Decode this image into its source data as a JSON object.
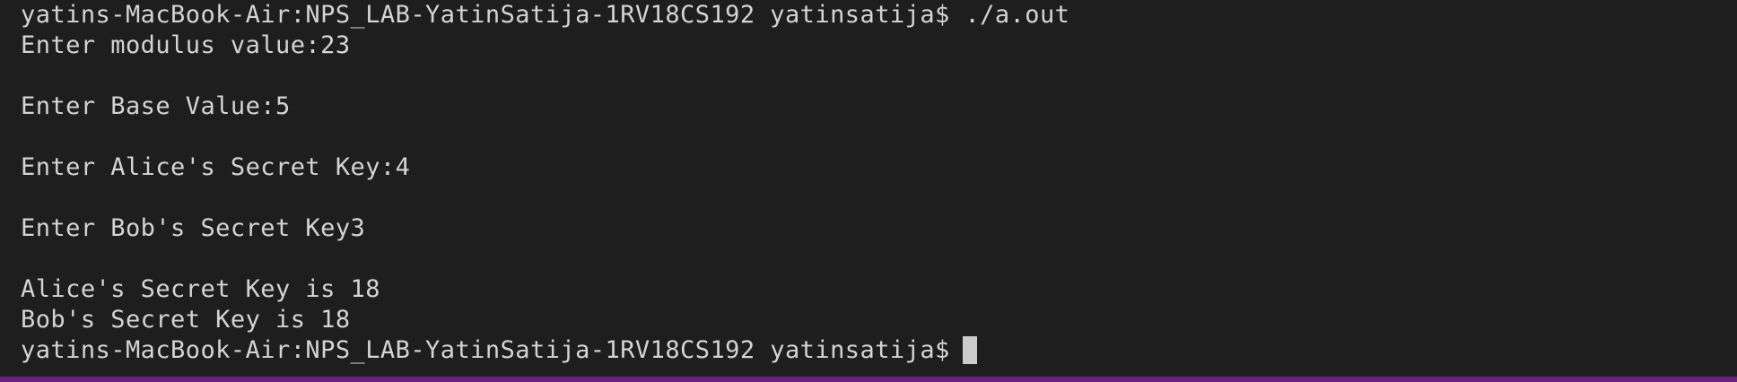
{
  "terminal": {
    "lines": [
      "yatins-MacBook-Air:NPS_LAB-YatinSatija-1RV18CS192 yatinsatija$ ./a.out",
      "Enter modulus value:23",
      "",
      "Enter Base Value:5",
      "",
      "Enter Alice's Secret Key:4",
      "",
      "Enter Bob's Secret Key3",
      "",
      "Alice's Secret Key is 18",
      "Bob's Secret Key is 18"
    ],
    "prompt": "yatins-MacBook-Air:NPS_LAB-YatinSatija-1RV18CS192 yatinsatija$"
  },
  "colors": {
    "background": "#1e1e1e",
    "text": "#d4d4d4",
    "cursor": "#cccccc",
    "status_bar": "#68217a"
  }
}
